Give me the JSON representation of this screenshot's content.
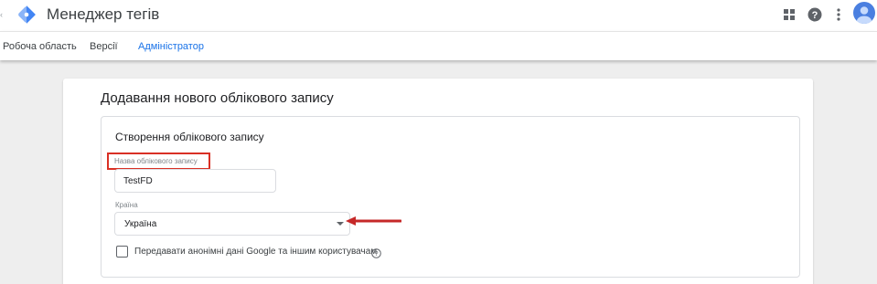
{
  "app": {
    "title": "Менеджер тегів"
  },
  "header_icons": [
    "apps-grid-icon",
    "help-icon",
    "more-vert-icon",
    "account-avatar-icon"
  ],
  "tabs": [
    {
      "label": "Робоча область",
      "active": false
    },
    {
      "label": "Версії",
      "active": false
    },
    {
      "label": "Адміністратор",
      "active": true
    }
  ],
  "page": {
    "title": "Додавання нового облікового запису"
  },
  "section": {
    "title": "Створення облікового запису",
    "account_name": {
      "label": "Назва облікового запису",
      "value": "TestFD"
    },
    "country": {
      "label": "Країна",
      "selected": "Україна"
    },
    "share_data": {
      "label": "Передавати анонімні дані Google та іншим користувачам",
      "checked": false
    }
  },
  "colors": {
    "accent": "#1a73e8",
    "annotation": "#d93025",
    "background": "#eeeeee"
  }
}
